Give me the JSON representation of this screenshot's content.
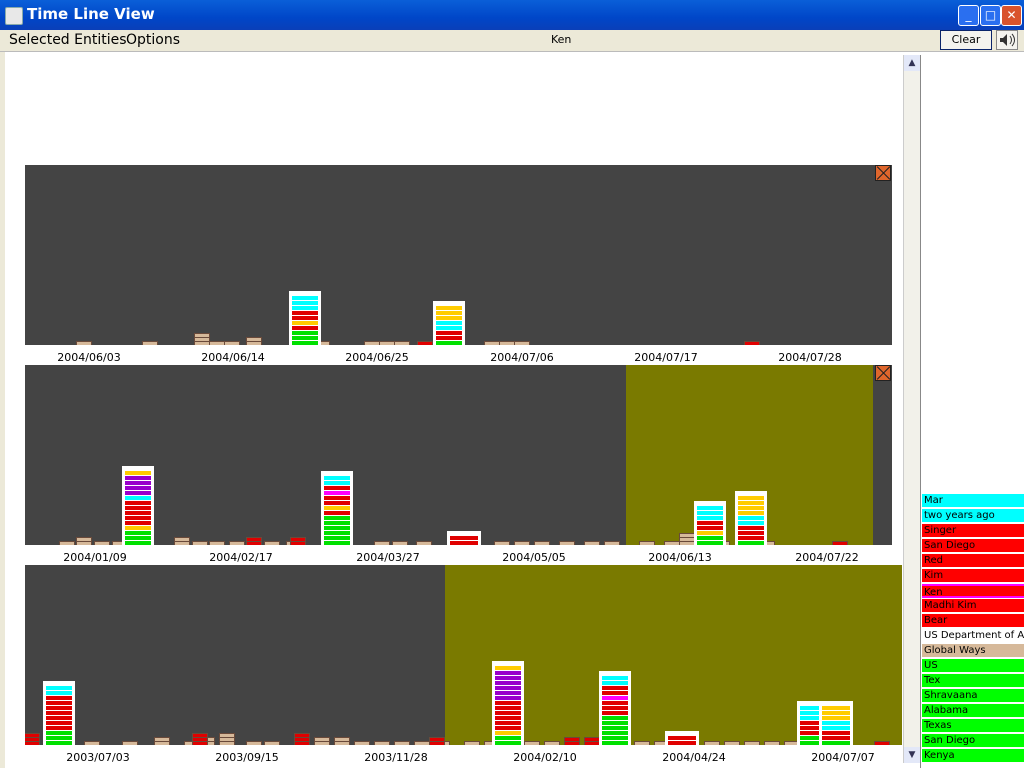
{
  "window": {
    "title": "Time Line View"
  },
  "menu": {
    "items": [
      "Selected Entities",
      "Options"
    ],
    "focus_entity": "Ken",
    "clear_label": "Clear"
  },
  "timelines": [
    {
      "ticks": [
        "2004/06/03",
        "2004/06/14",
        "2004/06/25",
        "2004/07/06",
        "2004/07/17",
        "2004/07/28"
      ]
    },
    {
      "ticks": [
        "2004/01/09",
        "2004/02/17",
        "2004/03/27",
        "2004/05/05",
        "2004/06/13",
        "2004/07/22"
      ]
    },
    {
      "ticks": [
        "2003/07/03",
        "2003/09/15",
        "2003/11/28",
        "2004/02/10",
        "2004/04/24",
        "2004/07/07"
      ]
    }
  ],
  "legend": [
    {
      "label": "Mar",
      "color": "#00ffff"
    },
    {
      "label": "two years ago",
      "color": "#00ffff"
    },
    {
      "label": "Singer",
      "color": "#ff0000"
    },
    {
      "label": "San Diego",
      "color": "#ff0000"
    },
    {
      "label": "Red",
      "color": "#ff0000"
    },
    {
      "label": "Kim",
      "color": "#ff0000"
    },
    {
      "label": "Ken",
      "color": "#ff00ff"
    },
    {
      "label": "Madhi Kim",
      "color": "#ff0000"
    },
    {
      "label": "Bear",
      "color": "#ff0000"
    },
    {
      "label": "US Department of Agr",
      "color": "#ffffff"
    },
    {
      "label": "Global Ways",
      "color": "#d6b99a"
    },
    {
      "label": "US",
      "color": "#00ff00"
    },
    {
      "label": "Tex",
      "color": "#00ff00"
    },
    {
      "label": "Shravaana",
      "color": "#00ff00"
    },
    {
      "label": "Alabama",
      "color": "#00ff00"
    },
    {
      "label": "Texas",
      "color": "#00ff00"
    },
    {
      "label": "San Diego",
      "color": "#00ff00"
    },
    {
      "label": "Kenya",
      "color": "#00ff00"
    }
  ]
}
